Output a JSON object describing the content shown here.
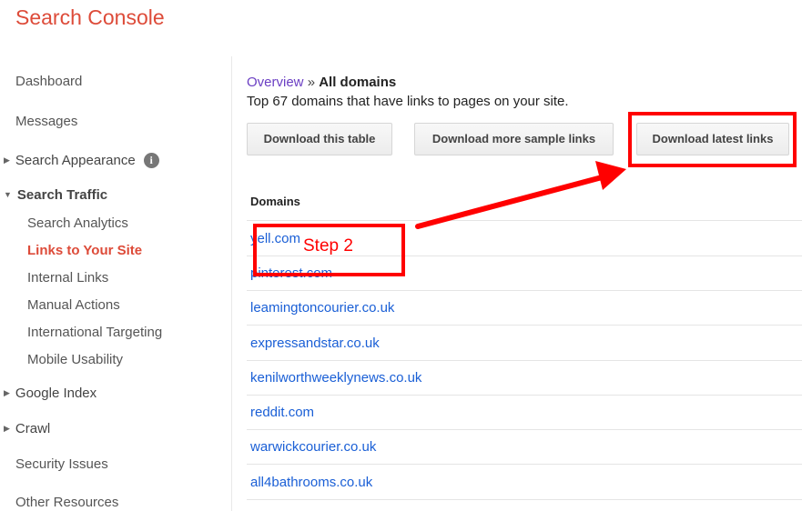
{
  "app": {
    "title": "Search Console"
  },
  "sidebar": {
    "dashboard": "Dashboard",
    "messages": "Messages",
    "search_appearance": "Search Appearance",
    "search_traffic": "Search Traffic",
    "search_traffic_items": {
      "search_analytics": "Search Analytics",
      "links_to_your_site": "Links to Your Site",
      "internal_links": "Internal Links",
      "manual_actions": "Manual Actions",
      "international_targeting": "International Targeting",
      "mobile_usability": "Mobile Usability"
    },
    "google_index": "Google Index",
    "crawl": "Crawl",
    "security_issues": "Security Issues",
    "other_resources": "Other Resources",
    "info_icon_glyph": "i"
  },
  "breadcrumb": {
    "overview": "Overview",
    "separator": "»",
    "current": "All domains"
  },
  "summary": "Top 67 domains that have links to pages on your site.",
  "buttons": {
    "download_table": "Download this table",
    "download_samples": "Download more sample links",
    "download_latest": "Download latest links"
  },
  "table": {
    "header": "Domains",
    "rows": [
      "yell.com",
      "pinterest.com",
      "leamingtoncourier.co.uk",
      "expressandstar.co.uk",
      "kenilworthweeklynews.co.uk",
      "reddit.com",
      "warwickcourier.co.uk",
      "all4bathrooms.co.uk"
    ]
  },
  "annotation": {
    "label": "Step 2",
    "color": "#ff0000"
  },
  "colors": {
    "brand": "#dd4b39",
    "link": "#1a5fd6",
    "visited": "#6b3fc3"
  }
}
